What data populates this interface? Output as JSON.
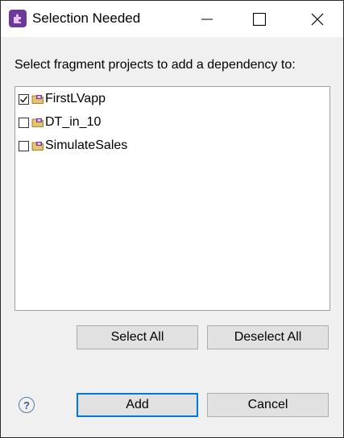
{
  "window": {
    "title": "Selection Needed",
    "app_icon": "eclipse-puzzle-icon",
    "controls": [
      "minimize-icon",
      "maximize-icon",
      "close-icon"
    ]
  },
  "instruction": "Select fragment projects to add a dependency to:",
  "projects": [
    {
      "name": "FirstLVapp",
      "checked": true
    },
    {
      "name": "DT_in_10",
      "checked": false
    },
    {
      "name": "SimulateSales",
      "checked": false
    }
  ],
  "buttons": {
    "select_all": "Select All",
    "deselect_all": "Deselect All",
    "add": "Add",
    "cancel": "Cancel"
  },
  "help": {
    "glyph": "?",
    "icon": "help-icon"
  },
  "colors": {
    "dialog_bg": "#f0f0f0",
    "button_bg": "#e1e1e1",
    "default_button_border": "#0078d7",
    "app_icon_bg": "#6d3a9c"
  }
}
